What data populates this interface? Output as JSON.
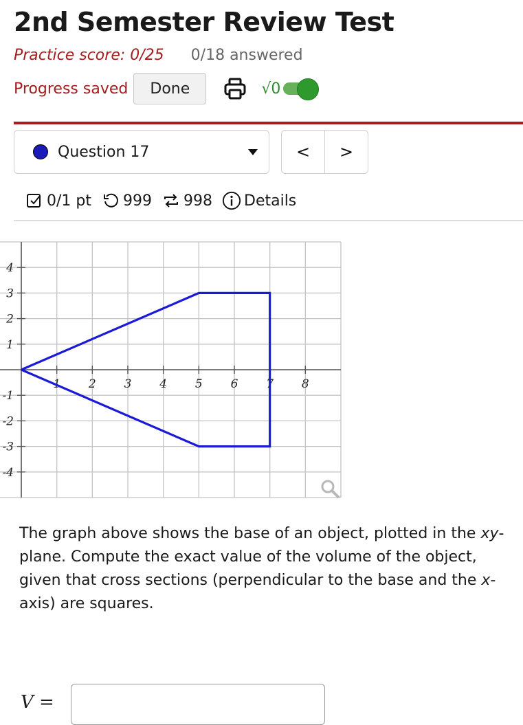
{
  "header": {
    "title": "2nd Semester Review Test",
    "practice_score": "Practice score: 0/25",
    "answered": "0/18 answered",
    "progress_saved": "Progress saved",
    "done_label": "Done",
    "sqrt_label": "√0"
  },
  "question_nav": {
    "selected": "Question 17",
    "prev_label": "<",
    "next_label": ">"
  },
  "meta": {
    "points": "0/1 pt",
    "retries": "999",
    "attempts": "998",
    "details": "Details"
  },
  "graph": {
    "x_ticks": [
      "1",
      "2",
      "3",
      "4",
      "5",
      "6",
      "7",
      "8"
    ],
    "y_ticks": [
      "4",
      "3",
      "2",
      "1",
      "-1",
      "-2",
      "-3",
      "-4"
    ],
    "x_range": [
      -0.6,
      9
    ],
    "y_range": [
      -5,
      5
    ],
    "shape_vertices": [
      [
        0,
        0
      ],
      [
        5,
        3
      ],
      [
        7,
        3
      ],
      [
        7,
        -3
      ],
      [
        5,
        -3
      ],
      [
        0,
        0
      ]
    ],
    "line_color": "#1b1bd6"
  },
  "prompt": {
    "before_xy": "The graph above shows the base of an object, plotted in the ",
    "xy": "xy",
    "middle": "-plane. Compute the exact value of the volume of the object, given that cross sections (perpendicular to the base and the ",
    "x": "x",
    "after": "-axis) are squares."
  },
  "answer": {
    "label": "V =",
    "value": ""
  }
}
